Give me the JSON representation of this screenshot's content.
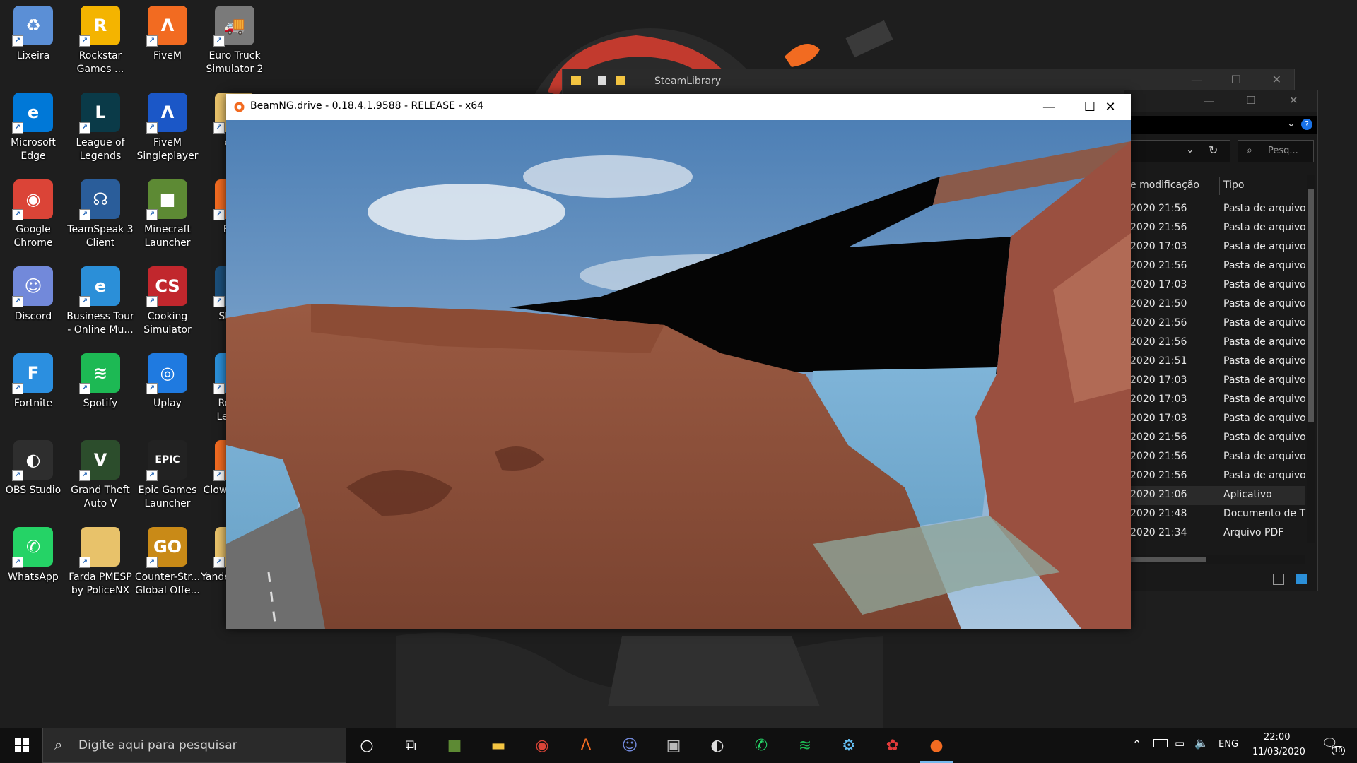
{
  "desktop": {
    "icons": [
      {
        "label": "Lixeira",
        "icon": "recycle-bin-icon",
        "color": "#5b8fd6",
        "glyph": "♻"
      },
      {
        "label": "Rockstar Games ...",
        "icon": "rockstar-icon",
        "color": "#f4b400",
        "glyph": "R"
      },
      {
        "label": "FiveM",
        "icon": "fivem-icon",
        "color": "#f26b21",
        "glyph": "Λ"
      },
      {
        "label": "Euro Truck Simulator 2",
        "icon": "truck-icon",
        "color": "#7a7a7a",
        "glyph": "🚚"
      },
      {
        "label": "Microsoft Edge",
        "icon": "edge-icon",
        "color": "#0078d7",
        "glyph": "e"
      },
      {
        "label": "League of Legends",
        "icon": "league-icon",
        "color": "#0a3a48",
        "glyph": "L"
      },
      {
        "label": "FiveM Singleplayer",
        "icon": "fivem-sp-icon",
        "color": "#1b57c7",
        "glyph": "Λ"
      },
      {
        "label": "clon",
        "icon": "folder-icon",
        "color": "#e8c26a",
        "glyph": ""
      },
      {
        "label": "Google Chrome",
        "icon": "chrome-icon",
        "color": "#db4437",
        "glyph": "◉"
      },
      {
        "label": "TeamSpeak 3 Client",
        "icon": "teamspeak-icon",
        "color": "#2a5d9a",
        "glyph": "☊"
      },
      {
        "label": "Minecraft Launcher",
        "icon": "minecraft-icon",
        "color": "#5d8a34",
        "glyph": "■"
      },
      {
        "label": "Bear",
        "icon": "beamng-icon",
        "color": "#f26b21",
        "glyph": "●"
      },
      {
        "label": "Discord",
        "icon": "discord-icon",
        "color": "#7289da",
        "glyph": "☺"
      },
      {
        "label": "Business Tour - Online Mu...",
        "icon": "ie-icon",
        "color": "#2b8fd8",
        "glyph": "e"
      },
      {
        "label": "Cooking Simulator",
        "icon": "cooking-icon",
        "color": "#c1272d",
        "glyph": "CS"
      },
      {
        "label": "Steam",
        "icon": "steam-icon",
        "color": "#1b4f7a",
        "glyph": "⚙"
      },
      {
        "label": "Fortnite",
        "icon": "fortnite-icon",
        "color": "#2b8fe0",
        "glyph": "F"
      },
      {
        "label": "Spotify",
        "icon": "spotify-icon",
        "color": "#1db954",
        "glyph": "≋"
      },
      {
        "label": "Uplay",
        "icon": "uplay-icon",
        "color": "#1f7ae0",
        "glyph": "◎"
      },
      {
        "label": "Rocket League",
        "icon": "ie-icon",
        "color": "#2b8fd8",
        "glyph": "e"
      },
      {
        "label": "OBS Studio",
        "icon": "obs-icon",
        "color": "#2e2e2e",
        "glyph": "◐"
      },
      {
        "label": "Grand Theft Auto V",
        "icon": "gta-icon",
        "color": "#2c4d2c",
        "glyph": "V"
      },
      {
        "label": "Epic Games Launcher",
        "icon": "epic-icon",
        "color": "#222222",
        "glyph": "EPIC"
      },
      {
        "label": "ClownfishV...",
        "icon": "clownfish-icon",
        "color": "#f26b21",
        "glyph": "◌"
      },
      {
        "label": "WhatsApp",
        "icon": "whatsapp-icon",
        "color": "#25d366",
        "glyph": "✆"
      },
      {
        "label": "Farda PMESP by PoliceNX",
        "icon": "folder-icon",
        "color": "#e8c26a",
        "glyph": ""
      },
      {
        "label": "Counter-Str... Global Offe...",
        "icon": "csgo-icon",
        "color": "#c98a17",
        "glyph": "GO"
      },
      {
        "label": "YandereSim...",
        "icon": "folder-icon",
        "color": "#e8c26a",
        "glyph": ""
      }
    ]
  },
  "explorer_back": {
    "title": "SteamLibrary"
  },
  "explorer_front": {
    "search_placeholder": "Pesq...",
    "col_date": "e modificação",
    "col_type": "Tipo",
    "rows": [
      {
        "d": "2020 21:56",
        "t": "Pasta de arquivo"
      },
      {
        "d": "2020 21:56",
        "t": "Pasta de arquivo"
      },
      {
        "d": "2020 17:03",
        "t": "Pasta de arquivo"
      },
      {
        "d": "2020 21:56",
        "t": "Pasta de arquivo"
      },
      {
        "d": "2020 17:03",
        "t": "Pasta de arquivo"
      },
      {
        "d": "2020 21:50",
        "t": "Pasta de arquivo"
      },
      {
        "d": "2020 21:56",
        "t": "Pasta de arquivo"
      },
      {
        "d": "2020 21:56",
        "t": "Pasta de arquivo"
      },
      {
        "d": "2020 21:51",
        "t": "Pasta de arquivo"
      },
      {
        "d": "2020 17:03",
        "t": "Pasta de arquivo"
      },
      {
        "d": "2020 17:03",
        "t": "Pasta de arquivo"
      },
      {
        "d": "2020 17:03",
        "t": "Pasta de arquivo"
      },
      {
        "d": "2020 21:56",
        "t": "Pasta de arquivo"
      },
      {
        "d": "2020 21:56",
        "t": "Pasta de arquivo"
      },
      {
        "d": "2020 21:56",
        "t": "Pasta de arquivo"
      },
      {
        "d": "2020 21:06",
        "t": "Aplicativo"
      },
      {
        "d": "2020 21:48",
        "t": "Documento de T"
      },
      {
        "d": "2020 21:34",
        "t": "Arquivo PDF"
      }
    ]
  },
  "beam_window": {
    "title": "BeamNG.drive - 0.18.4.1.9588 - RELEASE - x64",
    "minimize": "—",
    "maximize": "☐",
    "close": "✕"
  },
  "taskbar": {
    "search_placeholder": "Digite aqui para pesquisar",
    "apps": [
      {
        "icon": "cortana-icon",
        "glyph": "○",
        "color": "#ffffff"
      },
      {
        "icon": "task-view-icon",
        "glyph": "⧉",
        "color": "#ffffff"
      },
      {
        "icon": "minecraft-icon",
        "glyph": "■",
        "color": "#5d8a34"
      },
      {
        "icon": "file-explorer-icon",
        "glyph": "▬",
        "color": "#f4c542"
      },
      {
        "icon": "chrome-icon",
        "glyph": "◉",
        "color": "#db4437"
      },
      {
        "icon": "fivem-icon",
        "glyph": "Λ",
        "color": "#f26b21"
      },
      {
        "icon": "discord-icon",
        "glyph": "☺",
        "color": "#7289da"
      },
      {
        "icon": "truck-icon",
        "glyph": "▣",
        "color": "#bbbbbb"
      },
      {
        "icon": "obs-icon",
        "glyph": "◐",
        "color": "#dddddd"
      },
      {
        "icon": "whatsapp-icon",
        "glyph": "✆",
        "color": "#25d366"
      },
      {
        "icon": "spotify-icon",
        "glyph": "≋",
        "color": "#1db954"
      },
      {
        "icon": "steam-icon",
        "glyph": "⚙",
        "color": "#66c0f4"
      },
      {
        "icon": "cooking-icon",
        "glyph": "✿",
        "color": "#e33b3b"
      },
      {
        "icon": "beamng-icon",
        "glyph": "●",
        "color": "#f26b21"
      }
    ],
    "lang": "ENG",
    "time": "22:00",
    "date": "11/03/2020",
    "notifications": "10"
  }
}
